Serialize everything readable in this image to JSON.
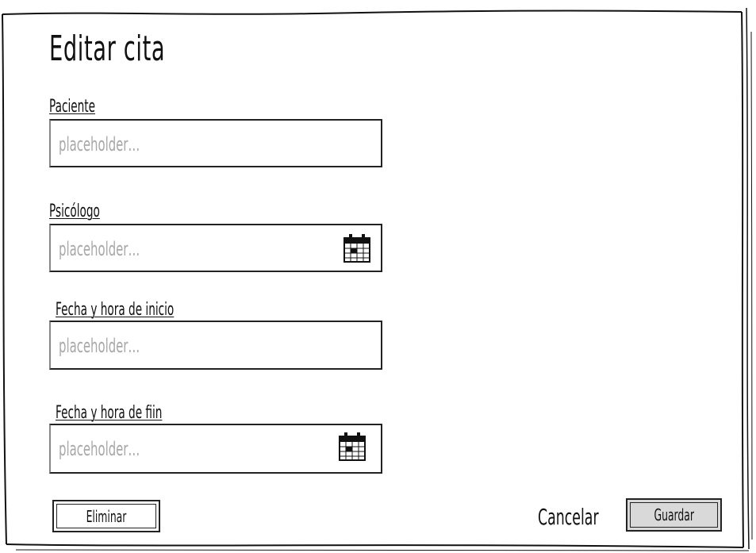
{
  "dialog": {
    "title": "Editar cita"
  },
  "fields": [
    {
      "label": "Paciente",
      "placeholder": "placeholder…",
      "icon": "none"
    },
    {
      "label": "Psicólogo",
      "placeholder": "placeholder…",
      "icon": "calendar-icon"
    },
    {
      "label": "Fecha y hora de inicio",
      "placeholder": "placeholder…",
      "icon": "none"
    },
    {
      "label": "Fecha y hora de fiin",
      "placeholder": "placeholder…",
      "icon": "calendar-icon"
    }
  ],
  "actions": {
    "delete_label": "Eliminar",
    "cancel_label": "Cancelar",
    "save_label": "Guardar"
  },
  "colors": {
    "placeholder": "#a8a8a8",
    "primary_button": "#d9d9d9",
    "stroke": "#222222"
  }
}
